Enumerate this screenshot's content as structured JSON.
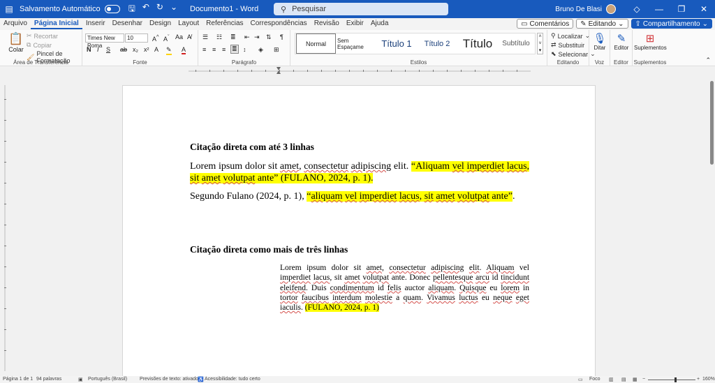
{
  "titlebar": {
    "autosave_label": "Salvamento Automático",
    "doc_title": "Documento1 - Word",
    "search_placeholder": "Pesquisar",
    "user_name": "Bruno De Blasi"
  },
  "menu": {
    "tabs": [
      "Arquivo",
      "Página Inicial",
      "Inserir",
      "Desenhar",
      "Design",
      "Layout",
      "Referências",
      "Correspondências",
      "Revisão",
      "Exibir",
      "Ajuda"
    ],
    "active_tab": "Página Inicial",
    "comments_label": "Comentários",
    "editing_label": "Editando",
    "share_label": "Compartilhamento"
  },
  "ribbon": {
    "clipboard": {
      "paste": "Colar",
      "cut": "Recortar",
      "copy": "Copiar",
      "format_painter": "Pincel de Formatação",
      "label": "Área de Transferência"
    },
    "font": {
      "family": "Times New Roma",
      "size": "10",
      "label": "Fonte"
    },
    "paragraph": {
      "label": "Parágrafo"
    },
    "styles": {
      "items": [
        "Normal",
        "Sem Espaçame",
        "Título 1",
        "Título 2",
        "Título",
        "Subtítulo"
      ],
      "label": "Estilos"
    },
    "editing": {
      "find": "Localizar",
      "replace": "Substituir",
      "select": "Selecionar",
      "label": "Editando"
    },
    "voice": {
      "dictate": "Ditar",
      "label": "Voz"
    },
    "editor": {
      "button": "Editor",
      "label": "Editor"
    },
    "addins": {
      "button": "Suplementos",
      "label": "Suplementos"
    }
  },
  "document": {
    "heading1": "Citação direta com até 3 linhas",
    "para1_plain": "Lorem ipsum dolor sit ",
    "para1_w1": "amet",
    "para1_sep1": ", ",
    "para1_w2": "consectetur",
    "para1_sep2": " ",
    "para1_w3": "adipiscing",
    "para1_sep3": " elit. ",
    "para1_quote_open": "“Aliquam ",
    "para1_q_w1": "vel",
    "para1_q_sp1": " ",
    "para1_q_w2": "imperdiet",
    "para1_q_sp2": " ",
    "para1_q_w3": "lacus",
    "para1_q_sp3": ", ",
    "para1_q_w4": "sit",
    "para1_q_sp4": " ",
    "para1_q_w5": "amet",
    "para1_q_sp5": " ",
    "para1_q_w6": "volutpat",
    "para1_q_rest": " ante” (FULANO, 2024, p. 1).",
    "para2_plain": "Segundo Fulano (2024, p. 1), ",
    "para2_q_open": "“",
    "para2_q_w1": "aliquam",
    "para2_q_sp1": " ",
    "para2_q_w2": "vel",
    "para2_q_sp2": " ",
    "para2_q_w3": "imperdiet",
    "para2_q_sp3": " ",
    "para2_q_w4": "lacus",
    "para2_q_sp4": ", ",
    "para2_q_w5": "sit",
    "para2_q_sp5": " ",
    "para2_q_w6": "amet",
    "para2_q_sp6": " ",
    "para2_q_w7": "volutpat",
    "para2_q_rest": " ante”",
    "para2_end": ".",
    "heading2": "Citação direta como mais de três linhas",
    "block_s1": "Lorem ipsum dolor sit ",
    "block_w1": "amet",
    "block_s2": ", ",
    "block_w2": "consectetur",
    "block_s3": " ",
    "block_w3": "adipiscing",
    "block_s4": " ",
    "block_w4": "elit",
    "block_s5": ". ",
    "block_w5": "Aliquam",
    "block_s6": " vel ",
    "block_w6": "imperdiet",
    "block_s7": " ",
    "block_w7": "lacus",
    "block_s8": ", sit ",
    "block_w8": "amet",
    "block_s9": " ",
    "block_w9": "volutpat",
    "block_s10": " ante. Donec ",
    "block_w10": "pellentesque",
    "block_s11": " ",
    "block_w11": "arcu",
    "block_s12": " id ",
    "block_w12": "tincidunt",
    "block_s13": " ",
    "block_w13": "eleifend",
    "block_s14": ". Duis ",
    "block_w14": "condimentum",
    "block_s15": " id ",
    "block_w15": "felis",
    "block_s16": " auctor ",
    "block_w16": "aliquam",
    "block_s17": ". ",
    "block_w17": "Quisque",
    "block_s18": " eu ",
    "block_w18": "lorem",
    "block_s19": " in ",
    "block_w19": "tortor",
    "block_s20": " ",
    "block_w20": "faucibus",
    "block_s21": " ",
    "block_w21": "interdum",
    "block_s22": " ",
    "block_w22": "molestie",
    "block_s23": " a ",
    "block_w23": "quam",
    "block_s24": ". ",
    "block_w24": "Vivamus",
    "block_s25": " ",
    "block_w25": "luctus",
    "block_s26": " eu ",
    "block_w26": "neque",
    "block_s27": " ",
    "block_w27": "eget",
    "block_s28": " ",
    "block_w28": "iaculis",
    "block_s29": ". ",
    "block_citation": "(FULANO, 2024, p. 1)"
  },
  "status": {
    "page": "Página 1 de 1",
    "words": "94 palavras",
    "language": "Português (Brasil)",
    "predictions": "Previsões de texto: ativado",
    "accessibility": "Acessibilidade: tudo certo",
    "focus": "Foco",
    "zoom": "160%"
  },
  "colors": {
    "accent": "#185abd",
    "highlight": "#ffff00",
    "squiggle": "#d4504c"
  }
}
